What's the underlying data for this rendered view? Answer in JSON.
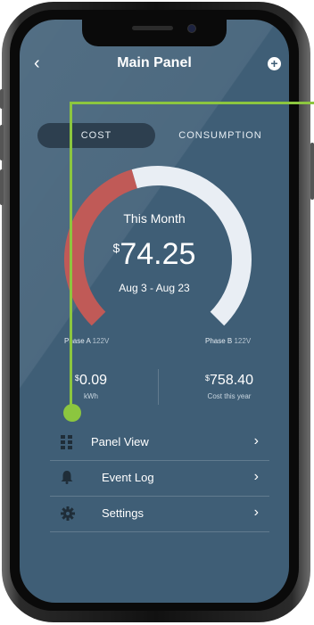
{
  "header": {
    "title": "Main Panel"
  },
  "segments": {
    "cost_label": "COST",
    "consumption_label": "CONSUMPTION"
  },
  "gauge": {
    "heading": "This Month",
    "currency": "$",
    "amount": "74.25",
    "date_range": "Aug 3 - Aug 23",
    "fill_fraction": 0.44,
    "colors": {
      "used": "#c05a57",
      "remaining": "#e9eef4"
    }
  },
  "phases": {
    "a_label": "Phase A",
    "a_volts": "122V",
    "b_label": "Phase B",
    "b_volts": "122V"
  },
  "stats": {
    "rate_currency": "$",
    "rate_value": "0.09",
    "rate_unit": "kWh",
    "year_currency": "$",
    "year_value": "758.40",
    "year_caption": "Cost this year"
  },
  "menu": [
    {
      "label": "Panel View",
      "icon": "panel-grid-icon"
    },
    {
      "label": "Event Log",
      "icon": "bell-icon"
    },
    {
      "label": "Settings",
      "icon": "gear-icon"
    }
  ],
  "colors": {
    "background": "#3f5e76",
    "accent_overlay": "#8cc63f"
  }
}
